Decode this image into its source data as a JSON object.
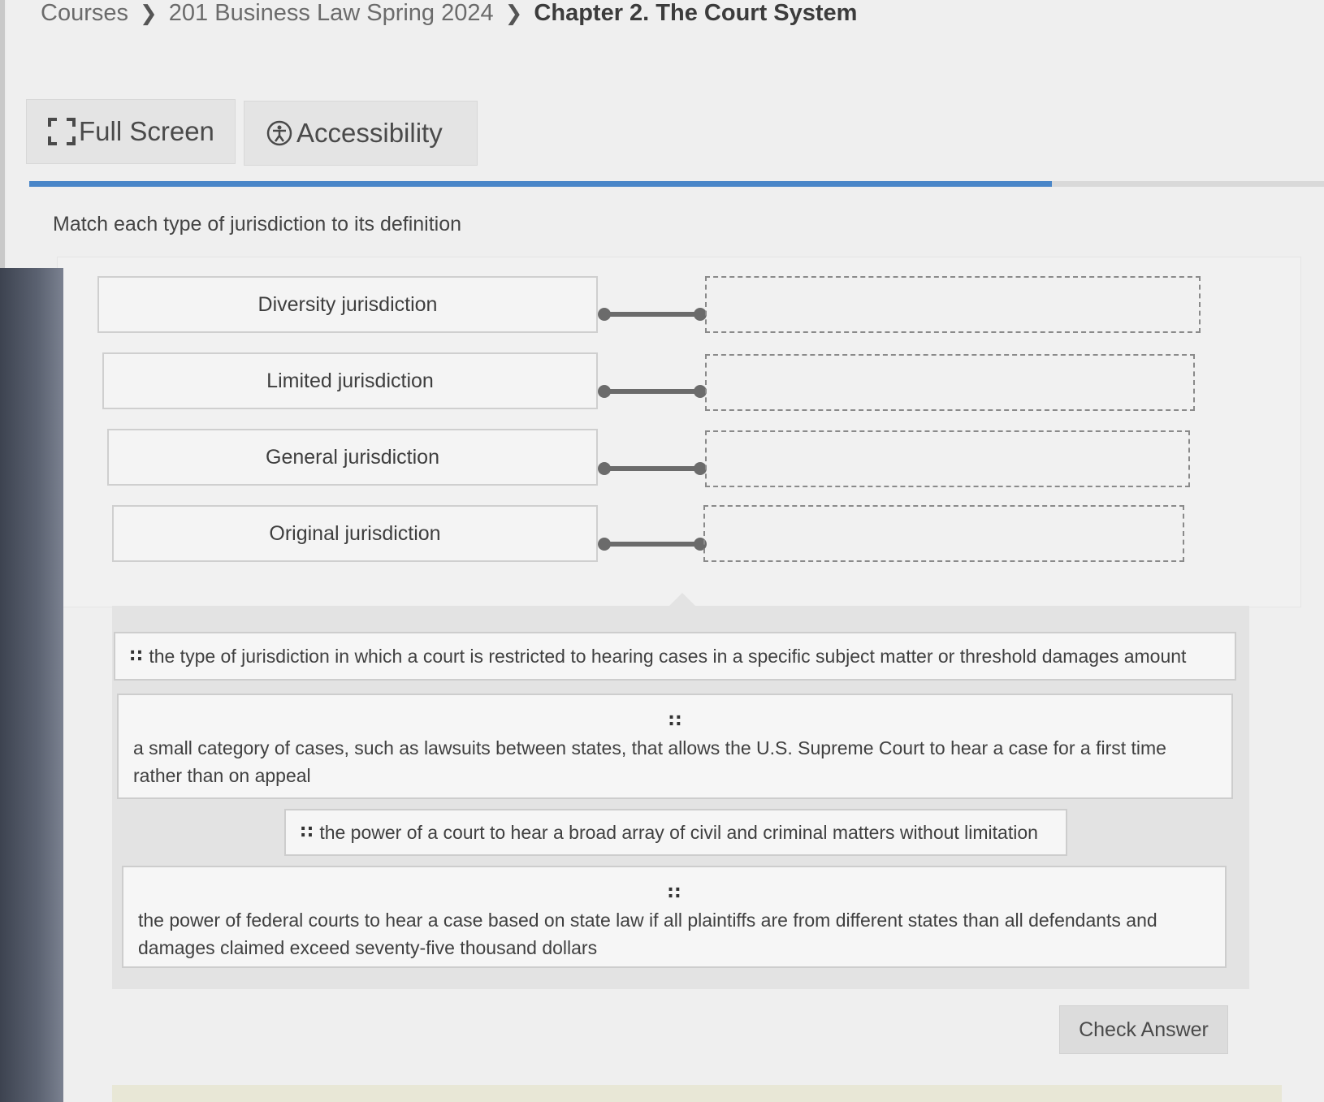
{
  "breadcrumb": {
    "items": [
      "Courses",
      "201 Business Law Spring 2024"
    ],
    "current": "Chapter 2. The Court System"
  },
  "toolbar": {
    "fullscreen_label": "Full Screen",
    "accessibility_label": "Accessibility"
  },
  "progress": {
    "fraction": 0.79
  },
  "question": {
    "instruction": "Match each type of jurisdiction to its definition"
  },
  "terms": [
    {
      "label": "Diversity jurisdiction"
    },
    {
      "label": "Limited jurisdiction"
    },
    {
      "label": "General jurisdiction"
    },
    {
      "label": "Original jurisdiction"
    }
  ],
  "answers": [
    {
      "text": "the type of jurisdiction in which a court is restricted to hearing cases in a specific subject matter or threshold damages amount"
    },
    {
      "text": "a small category of cases, such as lawsuits between states, that allows the U.S. Supreme Court to hear a case for a first time rather than on appeal"
    },
    {
      "text": "the power of a court to hear a broad array of civil and criminal matters without limitation"
    },
    {
      "text": "the power of federal courts to hear a case based on state law if all plaintiffs are from different states than all defendants and damages claimed exceed seventy-five thousand dollars"
    }
  ],
  "actions": {
    "check_answer_label": "Check Answer"
  },
  "colors": {
    "progress": "#4a86c8",
    "connector": "#6b6b6b"
  }
}
